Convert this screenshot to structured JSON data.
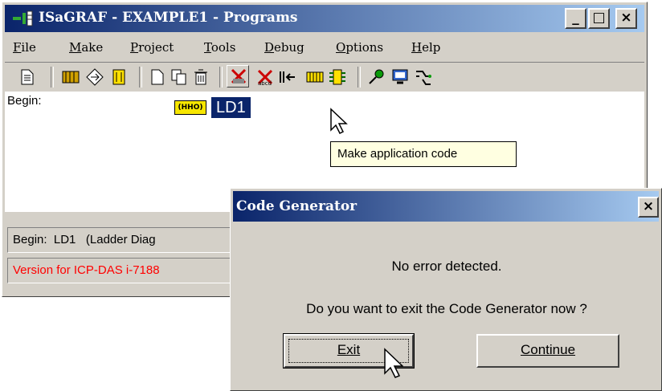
{
  "window": {
    "title": "ISaGRAF - EXAMPLE1 - Programs",
    "controls": {
      "minimize": "_",
      "maximize": "□",
      "close": "×"
    }
  },
  "menu": [
    "File",
    "Make",
    "Project",
    "Tools",
    "Debug",
    "Options",
    "Help"
  ],
  "program": {
    "section_label": "Begin:",
    "program_name": "LD1",
    "icon_text": "(HHO)"
  },
  "tooltip": "Make application code",
  "status": {
    "line1": "Begin:  LD1   (Ladder Diag",
    "line2": "Version for ICP-DAS i-7188"
  },
  "dialog": {
    "title": "Code Generator",
    "close": "×",
    "message1": "No error detected.",
    "message2": "Do you want to exit the Code Generator now ?",
    "exit_button": "Exit",
    "continue_button": "Continue"
  },
  "colors": {
    "titlebar_start": "#0a246a",
    "titlebar_end": "#a6caf0",
    "version_text": "#ff0000"
  }
}
